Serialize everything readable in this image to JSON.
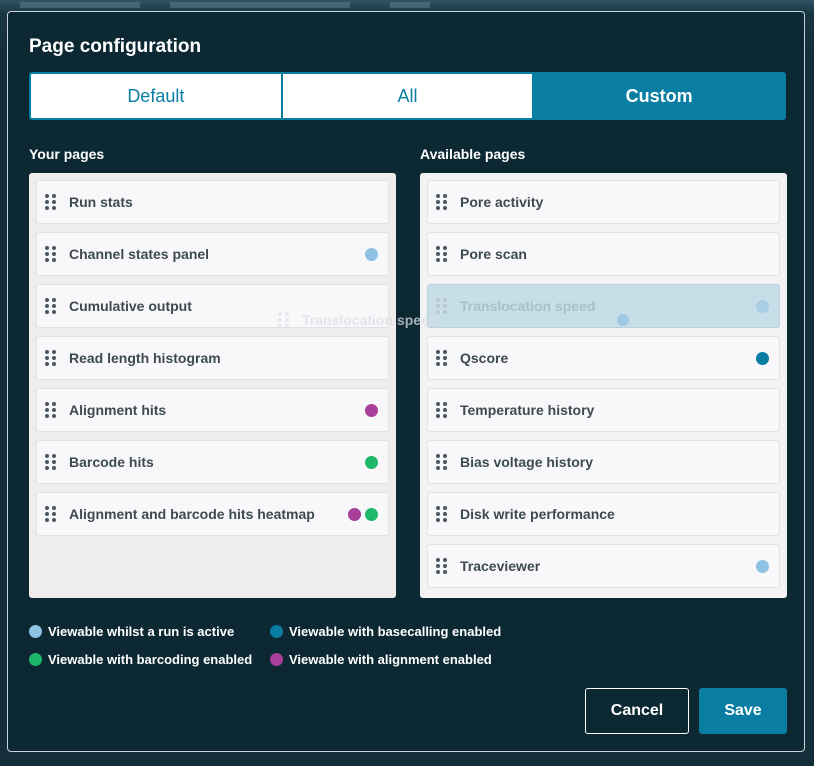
{
  "dialog": {
    "title": "Page configuration",
    "modes": [
      {
        "label": "Default",
        "active": false
      },
      {
        "label": "All",
        "active": false
      },
      {
        "label": "Custom",
        "active": true
      }
    ],
    "your_pages_heading": "Your pages",
    "available_pages_heading": "Available pages",
    "your_pages": [
      {
        "label": "Run stats",
        "dots": []
      },
      {
        "label": "Channel states panel",
        "dots": [
          "active_run"
        ]
      },
      {
        "label": "Cumulative output",
        "dots": []
      },
      {
        "label": "Read length histogram",
        "dots": []
      },
      {
        "label": "Alignment hits",
        "dots": [
          "alignment"
        ]
      },
      {
        "label": "Barcode hits",
        "dots": [
          "barcoding"
        ]
      },
      {
        "label": "Alignment and barcode hits heatmap",
        "dots": [
          "alignment",
          "barcoding"
        ]
      }
    ],
    "available_pages": [
      {
        "label": "Pore activity",
        "dots": []
      },
      {
        "label": "Pore scan",
        "dots": []
      },
      {
        "label": "Translocation speed",
        "dots": [
          "active_run"
        ],
        "ghost": true
      },
      {
        "label": "Qscore",
        "dots": [
          "basecalling"
        ]
      },
      {
        "label": "Temperature history",
        "dots": []
      },
      {
        "label": "Bias voltage history",
        "dots": []
      },
      {
        "label": "Disk write performance",
        "dots": []
      },
      {
        "label": "Traceviewer",
        "dots": [
          "active_run"
        ]
      }
    ],
    "drag_preview": {
      "label": "Translocation speed",
      "dot": "active_run"
    },
    "legend": [
      {
        "key": "active_run",
        "label": "Viewable whilst a run is active"
      },
      {
        "key": "basecalling",
        "label": "Viewable with basecalling enabled"
      },
      {
        "key": "barcoding",
        "label": "Viewable with barcoding enabled"
      },
      {
        "key": "alignment",
        "label": "Viewable with alignment enabled"
      }
    ],
    "buttons": {
      "cancel": "Cancel",
      "save": "Save"
    }
  },
  "colors": {
    "active_run": "#8fc1e3",
    "basecalling": "#0a7da3",
    "barcoding": "#1fb86a",
    "alignment": "#a83f9a",
    "accent": "#0a7da3",
    "dialog_bg": "#0c2833"
  },
  "icons": {
    "drag_handle": "drag-handle-icon",
    "status_dot": "status-dot-icon"
  }
}
